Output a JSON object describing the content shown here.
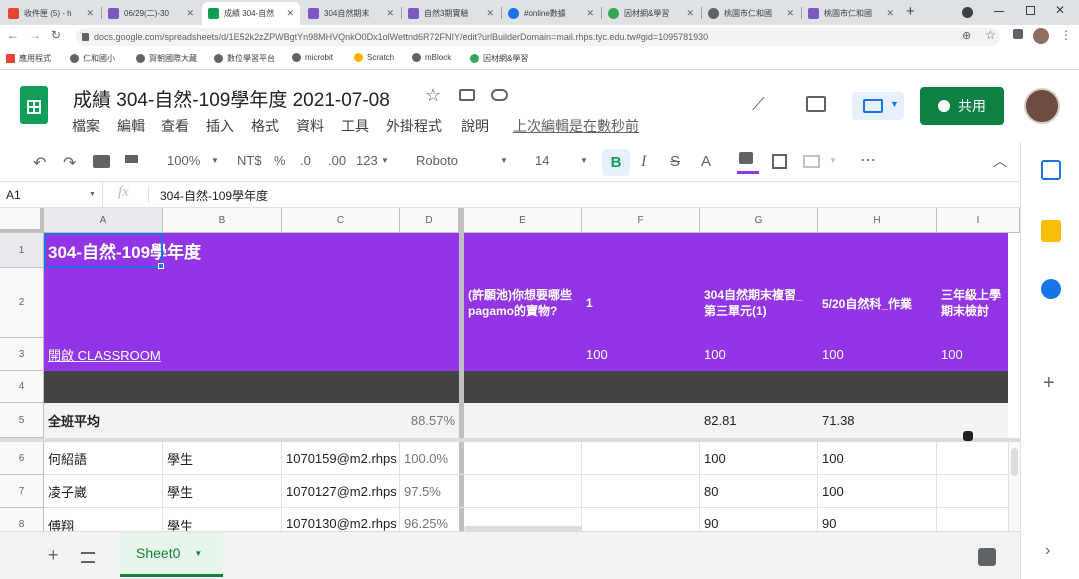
{
  "browser": {
    "tabs": [
      {
        "title": "收件匣 (5) - h",
        "color": "#ea4335"
      },
      {
        "title": "06/29(二)-30",
        "color": "#7e57c2"
      },
      {
        "title": "成績 304-自然",
        "color": "#0f9d58"
      },
      {
        "title": "304自然期末",
        "color": "#7e57c2"
      },
      {
        "title": "自然3期實驗",
        "color": "#7e57c2"
      },
      {
        "title": "#online數據",
        "color": "#1a73e8"
      },
      {
        "title": "因材網&學習",
        "color": "#34a853"
      },
      {
        "title": "桃園市仁和國",
        "color": "#5f6368"
      },
      {
        "title": "桃園市仁和國",
        "color": "#7e57c2"
      }
    ],
    "new_tab": "+",
    "url": "docs.google.com/spreadsheets/d/1E52k2zZPWBgtYn98MHVQnkO0Dx1olWettnd6R72FNIY/edit?urlBuilderDomain=mail.rhps.tyc.edu.tw#gid=1095781930",
    "bookmarks": [
      {
        "label": "應用程式",
        "color": "#5f6368"
      },
      {
        "label": "仁和國小",
        "color": "#5f6368"
      },
      {
        "label": "賀朝國際大藏",
        "color": "#5f6368"
      },
      {
        "label": "數位學習平台",
        "color": "#5f6368"
      },
      {
        "label": "microbit",
        "color": "#5f6368"
      },
      {
        "label": "Scratch",
        "color": "#f4b400"
      },
      {
        "label": "mBlock",
        "color": "#5f6368"
      },
      {
        "label": "因材網&學習",
        "color": "#34a853"
      }
    ]
  },
  "doc": {
    "title": "成績 304-自然-109學年度 2021-07-08",
    "menu": [
      "檔案",
      "編輯",
      "查看",
      "插入",
      "格式",
      "資料",
      "工具",
      "外掛程式",
      "說明"
    ],
    "last_edit": "上次編輯是在數秒前",
    "share_label": "共用"
  },
  "toolbar": {
    "zoom": "100%",
    "currency": "NT$",
    "percent": "%",
    "dec_less": ".0",
    "dec_more": ".00",
    "format": "123",
    "font": "Roboto",
    "size": "14",
    "bold": "B",
    "italic": "I",
    "strike": "S",
    "textcolor": "A"
  },
  "formula": {
    "cellref": "A1",
    "fx": "fx",
    "value": "304-自然-109學年度"
  },
  "grid": {
    "col_headers": [
      "A",
      "B",
      "C",
      "D",
      "E",
      "F",
      "G",
      "H",
      "I"
    ],
    "row_headers": [
      "1",
      "2",
      "3",
      "4",
      "5",
      "6",
      "7",
      "8"
    ],
    "a1": "304-自然-109學年度",
    "e2": "(許願池)你想要哪些pagamo的寶物?",
    "f2": "1",
    "g2": "304自然期末複習_第三單元(1)",
    "h2": "5/20自然科_作業",
    "i2": "三年級上學期末檢討",
    "a3": "開啟 CLASSROOM",
    "f3": "100",
    "g3": "100",
    "h3": "100",
    "i3": "100",
    "a5": "全班平均",
    "d5": "88.57%",
    "g5": "82.81",
    "h5": "71.38",
    "rows": [
      {
        "name": "何紹語",
        "role": "學生",
        "email": "1070159@m2.rhps",
        "pct": "100.0%",
        "g": "100",
        "h": "100"
      },
      {
        "name": "凌子崴",
        "role": "學生",
        "email": "1070127@m2.rhps",
        "pct": "97.5%",
        "g": "80",
        "h": "100"
      },
      {
        "name": "傅翔",
        "role": "學生",
        "email": "1070130@m2.rhps",
        "pct": "96.25%",
        "g": "90",
        "h": "90"
      }
    ]
  },
  "bottom": {
    "sheet_tab": "Sheet0",
    "add": "+"
  }
}
